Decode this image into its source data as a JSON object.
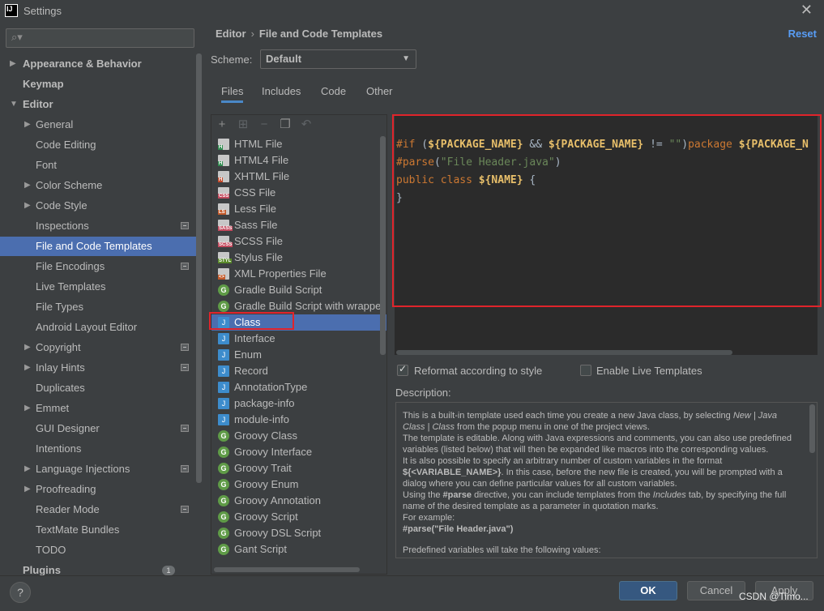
{
  "window": {
    "title": "Settings"
  },
  "sidebar": {
    "search_placeholder": "",
    "items": [
      {
        "label": "Appearance & Behavior"
      },
      {
        "label": "Keymap"
      },
      {
        "label": "Editor"
      },
      {
        "label": "General"
      },
      {
        "label": "Code Editing"
      },
      {
        "label": "Font"
      },
      {
        "label": "Color Scheme"
      },
      {
        "label": "Code Style"
      },
      {
        "label": "Inspections"
      },
      {
        "label": "File and Code Templates"
      },
      {
        "label": "File Encodings"
      },
      {
        "label": "Live Templates"
      },
      {
        "label": "File Types"
      },
      {
        "label": "Android Layout Editor"
      },
      {
        "label": "Copyright"
      },
      {
        "label": "Inlay Hints"
      },
      {
        "label": "Duplicates"
      },
      {
        "label": "Emmet"
      },
      {
        "label": "GUI Designer"
      },
      {
        "label": "Intentions"
      },
      {
        "label": "Language Injections"
      },
      {
        "label": "Proofreading"
      },
      {
        "label": "Reader Mode"
      },
      {
        "label": "TextMate Bundles"
      },
      {
        "label": "TODO"
      },
      {
        "label": "Plugins"
      }
    ],
    "plugins_badge": "1"
  },
  "breadcrumb": {
    "part1": "Editor",
    "separator": "›",
    "part2": "File and Code Templates"
  },
  "reset_label": "Reset",
  "scheme": {
    "label": "Scheme:",
    "value": "Default"
  },
  "tabs": [
    {
      "label": "Files"
    },
    {
      "label": "Includes"
    },
    {
      "label": "Code"
    },
    {
      "label": "Other"
    }
  ],
  "files": [
    {
      "name": "HTML File",
      "tag": "H",
      "color": "#2f8a4e"
    },
    {
      "name": "HTML4 File",
      "tag": "H",
      "color": "#2f8a4e"
    },
    {
      "name": "XHTML File",
      "tag": "H",
      "color": "#c34a2a"
    },
    {
      "name": "CSS File",
      "tag": "CSS",
      "color": "#c34a5e"
    },
    {
      "name": "Less File",
      "tag": "LS",
      "color": "#c35a2a"
    },
    {
      "name": "Sass File",
      "tag": "SASS",
      "color": "#c34a5e"
    },
    {
      "name": "SCSS File",
      "tag": "SCSS",
      "color": "#c34a5e"
    },
    {
      "name": "Stylus File",
      "tag": "STYL",
      "color": "#5a8a2a"
    },
    {
      "name": "XML Properties File",
      "tag": "<>",
      "color": "#c35a2a"
    },
    {
      "name": "Gradle Build Script",
      "tag": "G",
      "color": "#5f9b47"
    },
    {
      "name": "Gradle Build Script with wrapper",
      "tag": "G",
      "color": "#5f9b47"
    },
    {
      "name": "Class",
      "tag": "J",
      "color": "#3d8ccc"
    },
    {
      "name": "Interface",
      "tag": "J",
      "color": "#3d8ccc"
    },
    {
      "name": "Enum",
      "tag": "J",
      "color": "#3d8ccc"
    },
    {
      "name": "Record",
      "tag": "J",
      "color": "#3d8ccc"
    },
    {
      "name": "AnnotationType",
      "tag": "J",
      "color": "#3d8ccc"
    },
    {
      "name": "package-info",
      "tag": "J",
      "color": "#3d8ccc"
    },
    {
      "name": "module-info",
      "tag": "J",
      "color": "#3d8ccc"
    },
    {
      "name": "Groovy Class",
      "tag": "G",
      "color": "#5f9b47"
    },
    {
      "name": "Groovy Interface",
      "tag": "G",
      "color": "#5f9b47"
    },
    {
      "name": "Groovy Trait",
      "tag": "G",
      "color": "#5f9b47"
    },
    {
      "name": "Groovy Enum",
      "tag": "G",
      "color": "#5f9b47"
    },
    {
      "name": "Groovy Annotation",
      "tag": "G",
      "color": "#5f9b47"
    },
    {
      "name": "Groovy Script",
      "tag": "G",
      "color": "#5f9b47"
    },
    {
      "name": "Groovy DSL Script",
      "tag": "G",
      "color": "#5f9b47"
    },
    {
      "name": "Gant Script",
      "tag": "G",
      "color": "#5f9b47"
    }
  ],
  "editor": {
    "line1": {
      "kw": "#if",
      "p1": " (",
      "v1": "${PACKAGE_NAME}",
      "p2": " && ",
      "v2": "${PACKAGE_NAME}",
      "p3": " != ",
      "s1": "\"\"",
      "p4": ")",
      "kw2": "package",
      "p5": " ",
      "v3": "${PACKAGE_N"
    },
    "line2": {
      "kw": "#parse",
      "p1": "(",
      "s1": "\"File Header.java\"",
      "p2": ")"
    },
    "line3": {
      "kw1": "public",
      "sp": " ",
      "kw2": "class",
      "p1": " ",
      "v1": "${NAME}",
      "p2": " {"
    },
    "line4": "}"
  },
  "options": {
    "reformat": "Reformat according to style",
    "live_templates": "Enable Live Templates"
  },
  "description_label": "Description:",
  "description": {
    "p1a": "This is a built-in template used each time you create a new Java class, by selecting",
    "p1b_i": "New | Java Class | Class",
    "p1c": " from the popup menu in one of the project views.",
    "p2": "The template is editable. Along with Java expressions and comments, you can also use predefined variables (listed below) that will then be expanded like macros into the corresponding values.",
    "p3a": "It is also possible to specify an arbitrary number of custom variables in the format ",
    "p3b_b": "${<VARIABLE_NAME>}",
    "p3c": ". In this case, before the new file is created, you will be prompted with a dialog where you can define particular values for all custom variables.",
    "p4a": "Using the ",
    "p4b_b": "#parse",
    "p4c": " directive, you can include templates from the ",
    "p4d_i": "Includes",
    "p4e": " tab, by specifying the full name of the desired template as a parameter in quotation marks.",
    "p5": "For example:",
    "p6_b": "#parse(\"File Header.java\")",
    "p7": "Predefined variables will take the following values:"
  },
  "buttons": {
    "ok": "OK",
    "cancel": "Cancel",
    "apply": "Apply",
    "help": "?"
  },
  "watermark": "CSDN @Timo..."
}
